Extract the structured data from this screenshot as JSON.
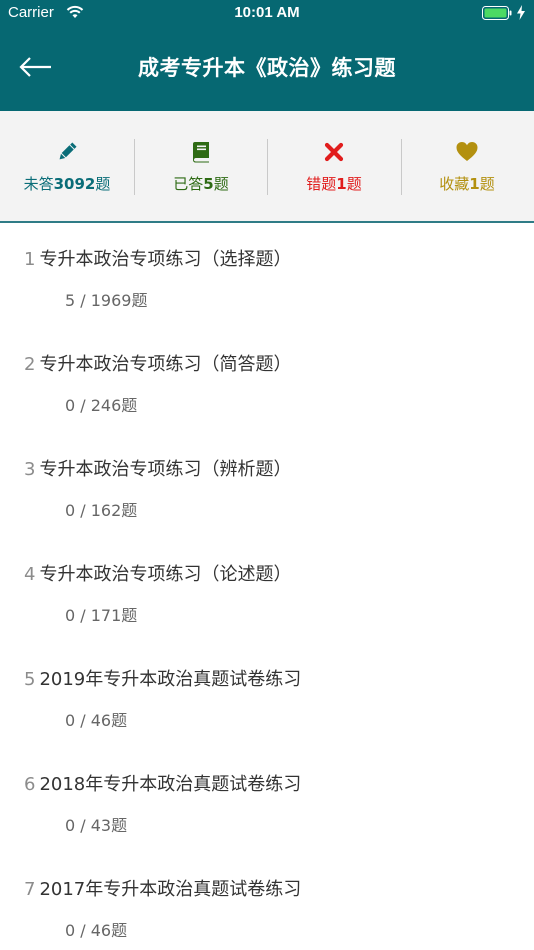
{
  "status": {
    "carrier": "Carrier",
    "time": "10:01 AM"
  },
  "nav": {
    "title": "成考专升本《政治》练习题"
  },
  "stats": [
    {
      "prefix": "未答",
      "count": "3092",
      "suffix": "题",
      "color": "#0a6d78",
      "icon": "pencil-icon"
    },
    {
      "prefix": "已答",
      "count": "5",
      "suffix": "题",
      "color": "#2e6b14",
      "icon": "book-icon"
    },
    {
      "prefix": "错题",
      "count": "1",
      "suffix": "题",
      "color": "#e11d1d",
      "icon": "x-icon"
    },
    {
      "prefix": "收藏",
      "count": "1",
      "suffix": "题",
      "color": "#b3900f",
      "icon": "heart-icon"
    }
  ],
  "items": [
    {
      "index": "1",
      "title": "专升本政治专项练习（选择题）",
      "progress": "5 / 1969题"
    },
    {
      "index": "2",
      "title": "专升本政治专项练习（简答题）",
      "progress": "0 / 246题"
    },
    {
      "index": "3",
      "title": "专升本政治专项练习（辨析题）",
      "progress": "0 / 162题"
    },
    {
      "index": "4",
      "title": "专升本政治专项练习（论述题）",
      "progress": "0 / 171题"
    },
    {
      "index": "5",
      "title": "2019年专升本政治真题试卷练习",
      "progress": "0 / 46题"
    },
    {
      "index": "6",
      "title": "2018年专升本政治真题试卷练习",
      "progress": "0 / 43题"
    },
    {
      "index": "7",
      "title": "2017年专升本政治真题试卷练习",
      "progress": "0 / 46题"
    }
  ]
}
